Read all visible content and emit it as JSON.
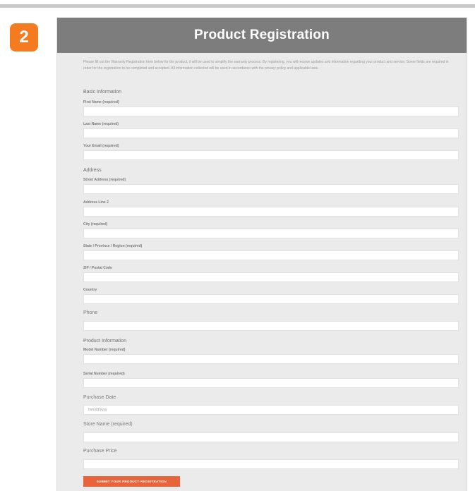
{
  "step_number": "2",
  "form": {
    "title": "Product Registration",
    "intro": "Please fill out the Warranty Registration form below for the product, it will be used to simplify the warranty process. By registering, you will receive updates and information regarding your product and service. Some fields are required in order for the registration to be completed and accepted. All information collected will be used in accordance with the privacy policy and applicable laws.",
    "sections": {
      "basic": "Basic Information",
      "address": "Address",
      "product": "Product Information"
    },
    "fields": {
      "first_name": "First Name (required)",
      "last_name": "Last Name (required)",
      "email": "Your Email (required)",
      "street": "Street Address (required)",
      "address2": "Address Line 2",
      "city": "City (required)",
      "state": "State / Province / Region (required)",
      "zip": "ZIP / Postal Code",
      "country": "Country",
      "phone": "Phone",
      "model": "Model Number (required)",
      "serial": "Serial Number (required)",
      "purchase_date": "Purchase Date",
      "purchase_date_placeholder": "mm/dd/yyyy",
      "store": "Store Name (required)",
      "price": "Purchase Price"
    },
    "submit_label": "SUBMIT YOUR PRODUCT REGISTRATION"
  },
  "colors": {
    "accent": "#f47b20",
    "header": "#7d7d7d",
    "button": "#e8643a"
  }
}
